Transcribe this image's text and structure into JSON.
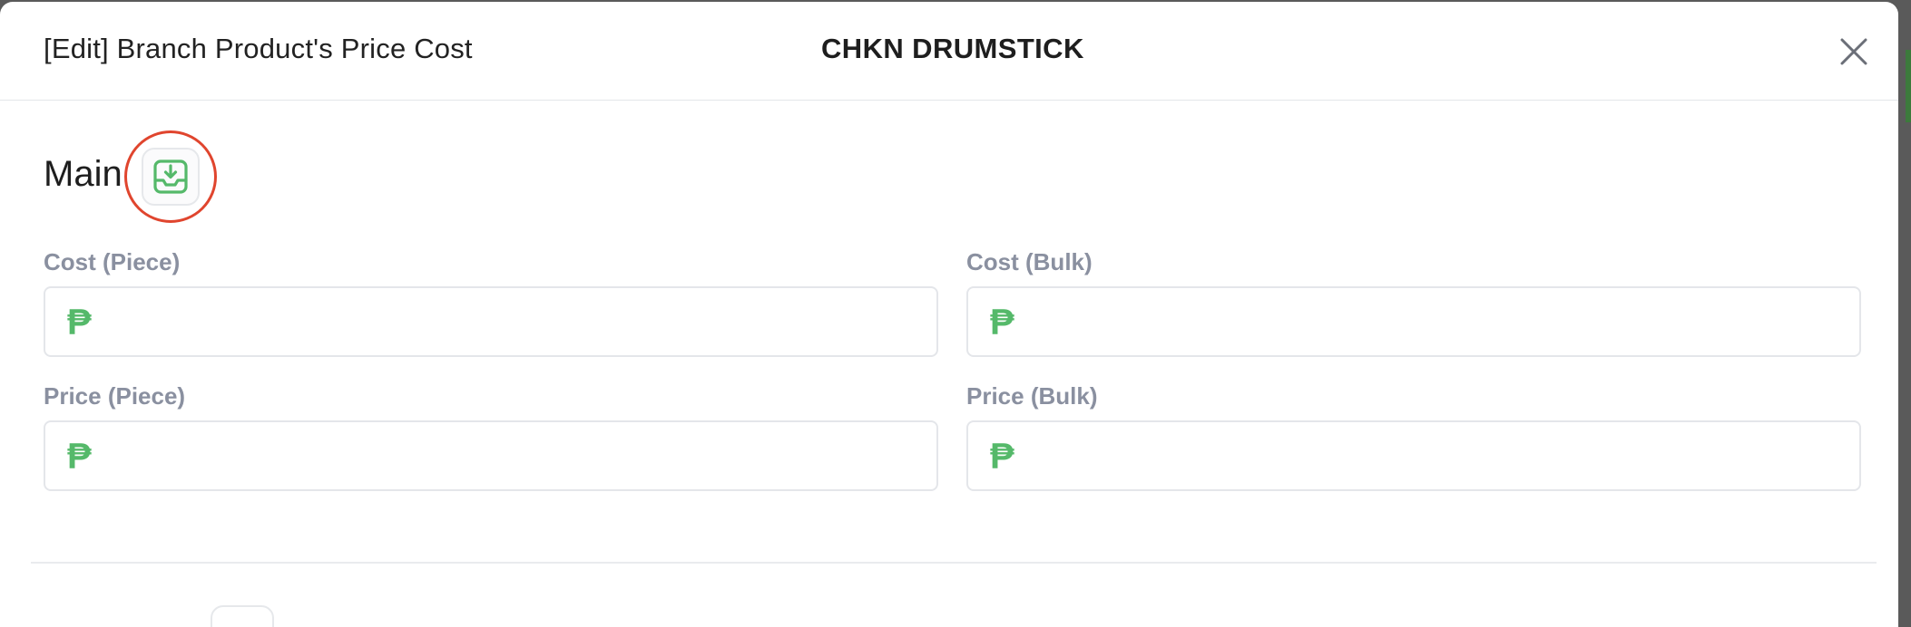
{
  "modal": {
    "title": "[Edit] Branch Product's Price Cost",
    "product_name": "CHKN DRUMSTICK"
  },
  "main_section": {
    "title": "Main",
    "fields": {
      "cost_piece": {
        "label": "Cost (Piece)",
        "currency": "₱",
        "value": ""
      },
      "cost_bulk": {
        "label": "Cost (Bulk)",
        "currency": "₱",
        "value": ""
      },
      "price_piece": {
        "label": "Price (Piece)",
        "currency": "₱",
        "value": ""
      },
      "price_bulk": {
        "label": "Price (Bulk)",
        "currency": "₱",
        "value": ""
      }
    }
  },
  "icons": {
    "close": "close-icon",
    "save": "inbox-download-icon"
  },
  "colors": {
    "accent_green": "#55b96a",
    "highlight_red": "#e0452e",
    "label_gray": "#8a90a0"
  }
}
